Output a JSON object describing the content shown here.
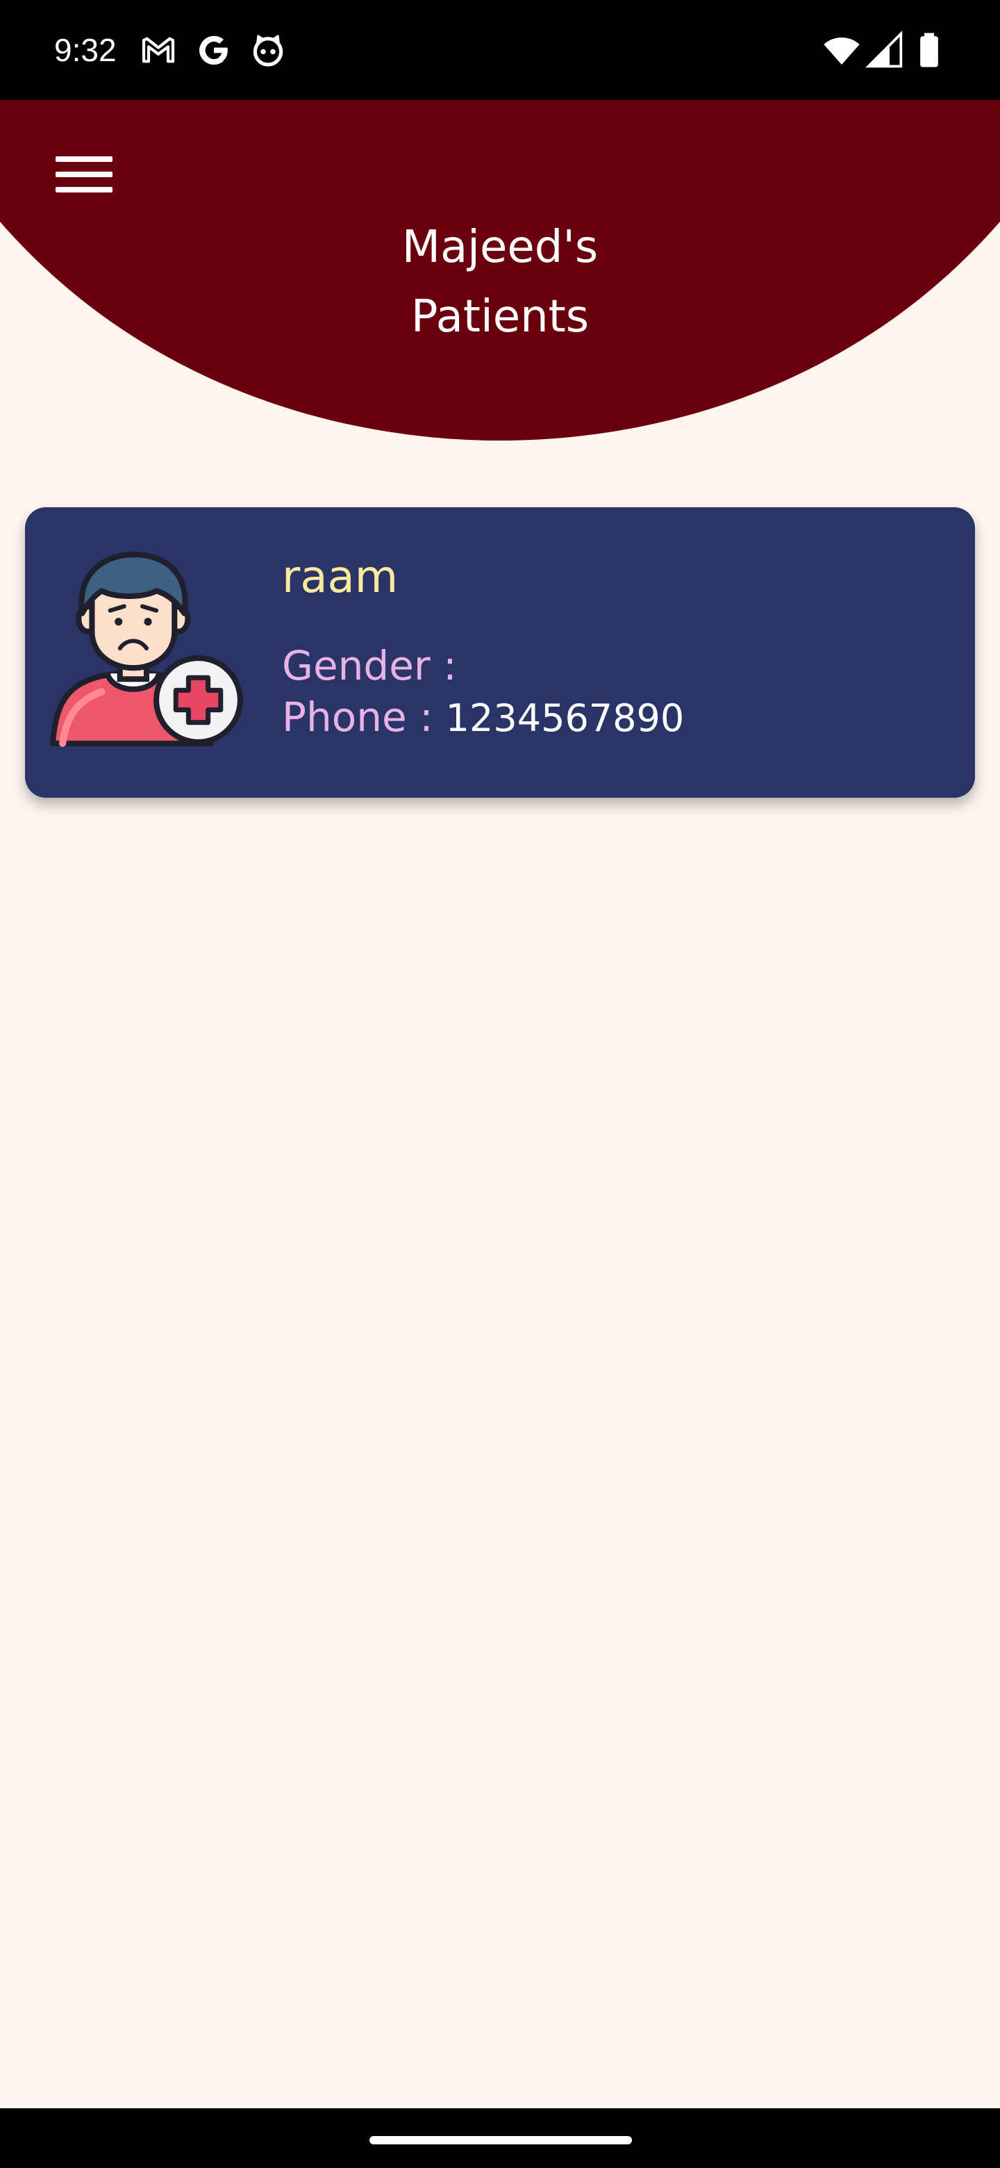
{
  "status_bar": {
    "time": "9:32",
    "left_icons": [
      "gmail-icon",
      "google-icon",
      "cat-face-icon"
    ],
    "right_icons": [
      "wifi-icon",
      "cell-signal-icon",
      "battery-icon"
    ]
  },
  "header": {
    "menu_icon": "hamburger-menu-icon",
    "title_line1": "Majeed's",
    "title_line2": "Patients",
    "background_color": "#6A000D"
  },
  "patients": [
    {
      "name": "raam",
      "gender_label": "Gender :",
      "gender_value": "",
      "phone_label": "Phone :",
      "phone_value": "1234567890",
      "avatar_icon": "patient-avatar-icon",
      "card_color": "#2B3467"
    }
  ],
  "colors": {
    "page_background": "#FFF5EF",
    "name_color": "#FCEB9C",
    "label_color": "#E7B3E4",
    "value_color": "#FFFFFF"
  }
}
